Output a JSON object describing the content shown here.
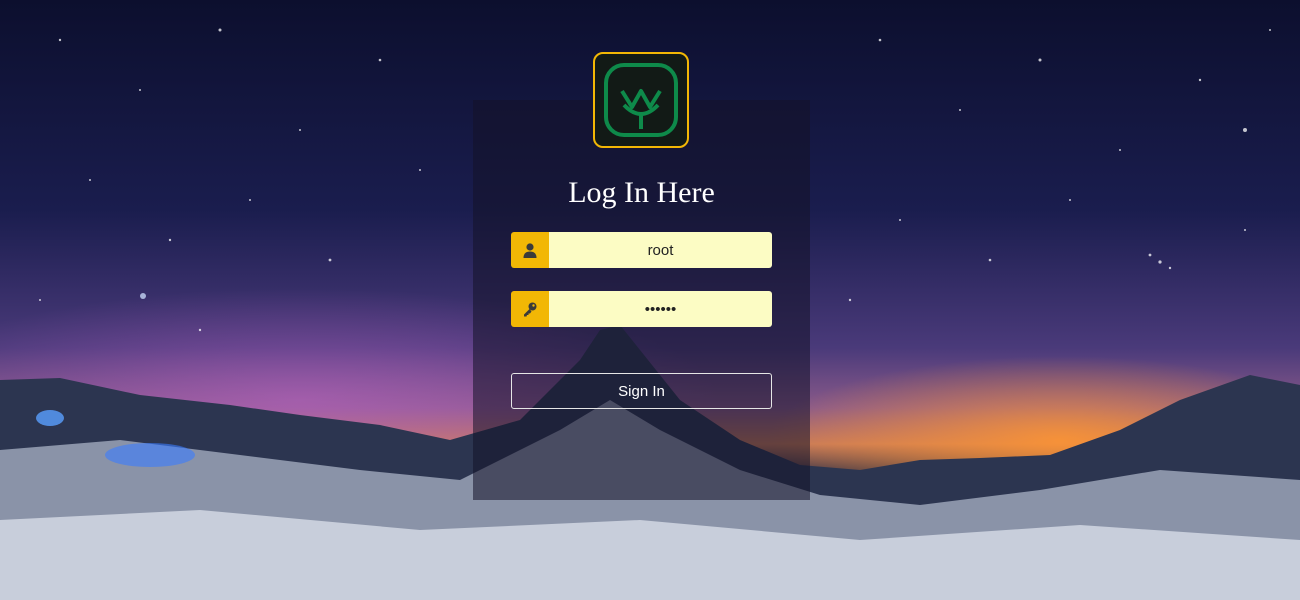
{
  "login": {
    "title": "Log In Here",
    "username_value": "root",
    "password_value": "••••••",
    "signin_label": "Sign In"
  },
  "icons": {
    "username": "user-icon",
    "password": "key-icon",
    "logo": "leaf-logo-icon"
  },
  "colors": {
    "accent": "#f2b705",
    "input_bg": "#fcfcc4",
    "logo_green": "#0e8a4a"
  }
}
